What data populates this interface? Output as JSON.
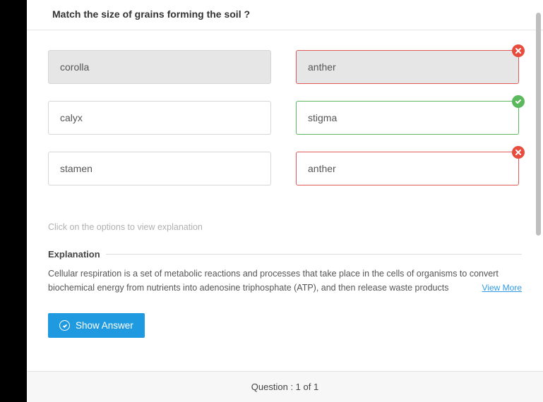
{
  "question": {
    "prompt": "Match the size of grains forming the soil ?"
  },
  "left_items": [
    {
      "label": "corolla",
      "shaded": true
    },
    {
      "label": "calyx",
      "shaded": false
    },
    {
      "label": "stamen",
      "shaded": false
    }
  ],
  "right_items": [
    {
      "label": "anther",
      "shaded": true,
      "status": "wrong"
    },
    {
      "label": "stigma",
      "shaded": false,
      "status": "correct"
    },
    {
      "label": "anther",
      "shaded": false,
      "status": "wrong"
    }
  ],
  "hint_text": "Click on the options to view explanation",
  "explanation": {
    "title": "Explanation",
    "body": "Cellular respiration is a set of metabolic reactions and processes that take place in the cells of organisms to convert biochemical energy from nutrients into adenosine triphosphate (ATP), and then release waste products",
    "view_more": "View More"
  },
  "buttons": {
    "show_answer": "Show Answer"
  },
  "footer": {
    "progress": "Question : 1 of 1"
  }
}
